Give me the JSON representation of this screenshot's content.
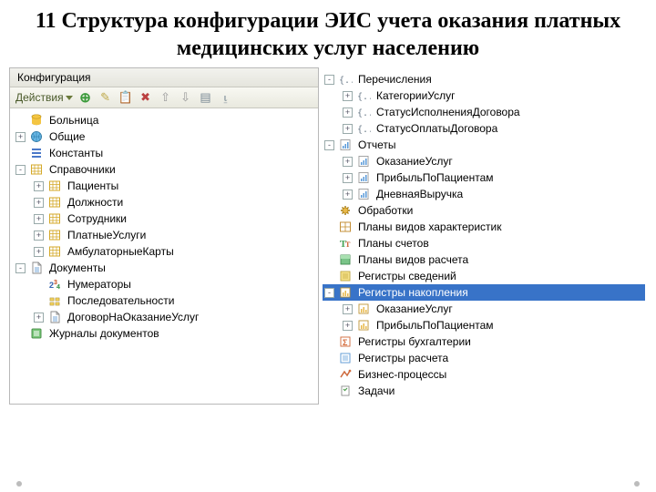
{
  "title": "11 Структура конфигурации ЭИС учета оказания платных медицинских услуг населению",
  "panel": {
    "title": "Конфигурация"
  },
  "toolbar": {
    "actions": "Действия"
  },
  "left": [
    {
      "depth": 0,
      "tog": "",
      "icon": "db-yellow",
      "label": "Больница"
    },
    {
      "depth": 0,
      "tog": "+",
      "icon": "globe",
      "label": "Общие"
    },
    {
      "depth": 0,
      "tog": "",
      "icon": "bars-blue",
      "label": "Константы"
    },
    {
      "depth": 0,
      "tog": "-",
      "icon": "table",
      "label": "Справочники"
    },
    {
      "depth": 1,
      "tog": "+",
      "icon": "table",
      "label": "Пациенты"
    },
    {
      "depth": 1,
      "tog": "+",
      "icon": "table",
      "label": "Должности"
    },
    {
      "depth": 1,
      "tog": "+",
      "icon": "table",
      "label": "Сотрудники"
    },
    {
      "depth": 1,
      "tog": "+",
      "icon": "table",
      "label": "ПлатныеУслуги"
    },
    {
      "depth": 1,
      "tog": "+",
      "icon": "table",
      "label": "АмбулаторныеКарты"
    },
    {
      "depth": 0,
      "tog": "-",
      "icon": "doc",
      "label": "Документы"
    },
    {
      "depth": 1,
      "tog": "",
      "icon": "num",
      "label": "Нумераторы"
    },
    {
      "depth": 1,
      "tog": "",
      "icon": "seq",
      "label": "Последовательности"
    },
    {
      "depth": 1,
      "tog": "+",
      "icon": "doc",
      "label": "ДоговорНаОказаниеУслуг"
    },
    {
      "depth": 0,
      "tog": "",
      "icon": "journal",
      "label": "Журналы документов"
    }
  ],
  "right": [
    {
      "depth": 0,
      "tog": "-",
      "icon": "enum",
      "label": "Перечисления"
    },
    {
      "depth": 1,
      "tog": "+",
      "icon": "enum",
      "label": "КатегорииУслуг"
    },
    {
      "depth": 1,
      "tog": "+",
      "icon": "enum",
      "label": "СтатусИсполненияДоговора"
    },
    {
      "depth": 1,
      "tog": "+",
      "icon": "enum",
      "label": "СтатусОплатыДоговора"
    },
    {
      "depth": 0,
      "tog": "-",
      "icon": "report",
      "label": "Отчеты"
    },
    {
      "depth": 1,
      "tog": "+",
      "icon": "report",
      "label": "ОказаниеУслуг"
    },
    {
      "depth": 1,
      "tog": "+",
      "icon": "report",
      "label": "ПрибыльПоПациентам"
    },
    {
      "depth": 1,
      "tog": "+",
      "icon": "report",
      "label": "ДневнаяВыручка"
    },
    {
      "depth": 0,
      "tog": "",
      "icon": "gear",
      "label": "Обработки"
    },
    {
      "depth": 0,
      "tog": "",
      "icon": "pvchar",
      "label": "Планы видов характеристик"
    },
    {
      "depth": 0,
      "tog": "",
      "icon": "tt",
      "label": "Планы счетов"
    },
    {
      "depth": 0,
      "tog": "",
      "icon": "calc",
      "label": "Планы видов расчета"
    },
    {
      "depth": 0,
      "tog": "",
      "icon": "reginfo",
      "label": "Регистры сведений"
    },
    {
      "depth": 0,
      "tog": "-",
      "icon": "regacc",
      "label": "Регистры накопления",
      "selected": true
    },
    {
      "depth": 1,
      "tog": "+",
      "icon": "regacc",
      "label": "ОказаниеУслуг"
    },
    {
      "depth": 1,
      "tog": "+",
      "icon": "regacc",
      "label": "ПрибыльПоПациентам"
    },
    {
      "depth": 0,
      "tog": "",
      "icon": "regbuh",
      "label": "Регистры бухгалтерии"
    },
    {
      "depth": 0,
      "tog": "",
      "icon": "regcalc",
      "label": "Регистры расчета"
    },
    {
      "depth": 0,
      "tog": "",
      "icon": "biz",
      "label": "Бизнес-процессы"
    },
    {
      "depth": 0,
      "tog": "",
      "icon": "task",
      "label": "Задачи"
    }
  ]
}
